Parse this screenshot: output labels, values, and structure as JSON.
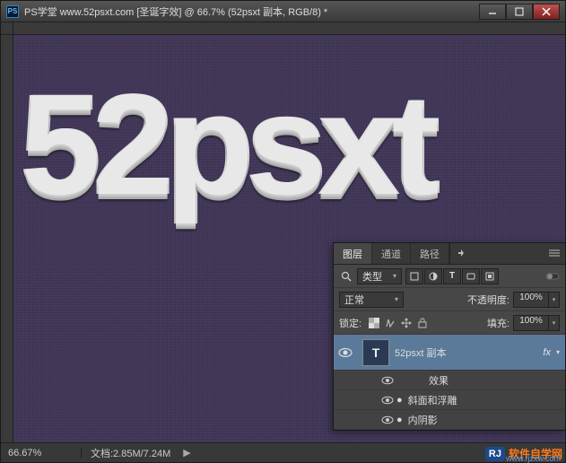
{
  "titlebar": {
    "ps": "PS",
    "title": "PS学堂  www.52psxt.com [圣诞字效] @ 66.7% (52psxt 副本, RGB/8) *"
  },
  "canvas": {
    "display_text": "52psxt"
  },
  "statusbar": {
    "zoom": "66.67%",
    "doc": "文档:2.85M/7.24M"
  },
  "layers": {
    "tabs": {
      "layers": "图层",
      "channels": "通道",
      "paths": "路径"
    },
    "filter_label": "类型",
    "blend": {
      "mode": "正常",
      "opacity_label": "不透明度:",
      "opacity": "100%"
    },
    "lock": {
      "label": "锁定:",
      "fill_label": "填充:",
      "fill": "100%"
    },
    "items": [
      {
        "name": "52psxt 副本",
        "fx": "fx"
      }
    ],
    "effects": {
      "label": "效果",
      "list": [
        "斜面和浮雕",
        "内阴影"
      ]
    }
  },
  "watermark": {
    "badge": "RJ",
    "text": "软件自学网",
    "url": "www.rjzxw.com"
  }
}
